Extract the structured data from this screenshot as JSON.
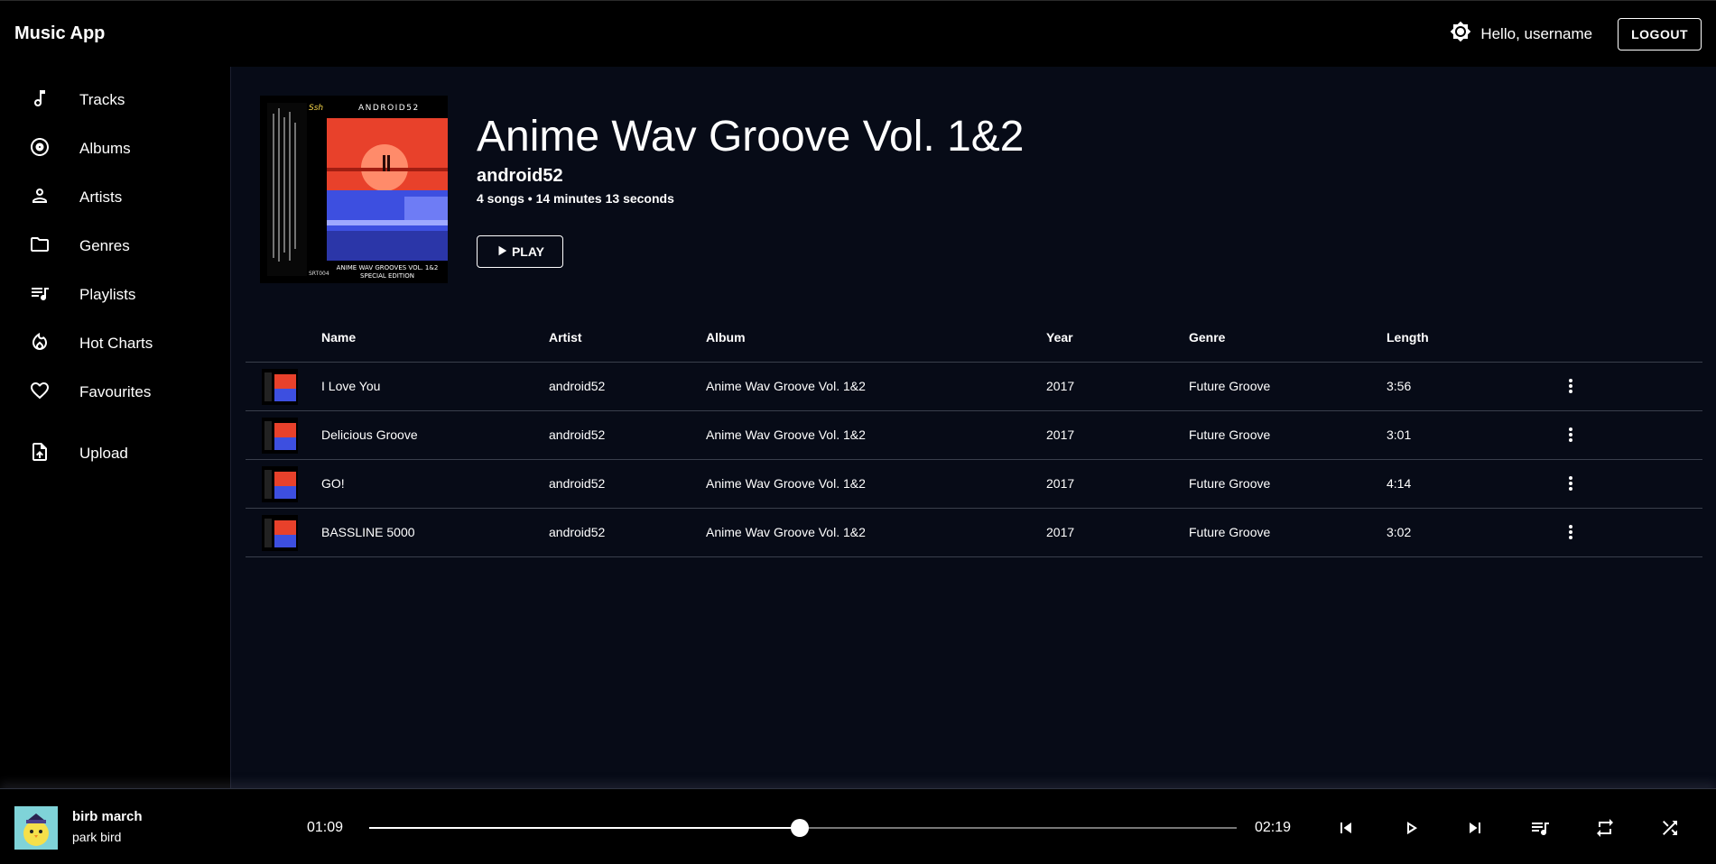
{
  "app": {
    "title": "Music App"
  },
  "header": {
    "greeting": "Hello, username",
    "logout_label": "LOGOUT",
    "theme_icon": "brightness-icon"
  },
  "sidebar": {
    "items": [
      {
        "label": "Tracks",
        "icon": "music-note-icon"
      },
      {
        "label": "Albums",
        "icon": "album-icon"
      },
      {
        "label": "Artists",
        "icon": "person-icon"
      },
      {
        "label": "Genres",
        "icon": "folder-icon"
      },
      {
        "label": "Playlists",
        "icon": "playlist-icon"
      },
      {
        "label": "Hot Charts",
        "icon": "flame-icon"
      },
      {
        "label": "Favourites",
        "icon": "heart-icon"
      },
      {
        "label": "Upload",
        "icon": "upload-file-icon"
      }
    ]
  },
  "album": {
    "title": "Anime Wav Groove Vol. 1&2",
    "artist": "android52",
    "meta": "4 songs • 14 minutes 13 seconds",
    "play_label": "PLAY",
    "cover": {
      "brand": "ANDROID52",
      "caption1": "ANIME WAV GROOVES VOL. 1&2",
      "caption2": "SPECIAL EDITION",
      "code": "SRT004"
    }
  },
  "table": {
    "columns": [
      "Name",
      "Artist",
      "Album",
      "Year",
      "Genre",
      "Length"
    ],
    "rows": [
      {
        "name": "I Love You",
        "artist": "android52",
        "album": "Anime Wav Groove Vol. 1&2",
        "year": "2017",
        "genre": "Future Groove",
        "length": "3:56"
      },
      {
        "name": "Delicious Groove",
        "artist": "android52",
        "album": "Anime Wav Groove Vol. 1&2",
        "year": "2017",
        "genre": "Future Groove",
        "length": "3:01"
      },
      {
        "name": "GO!",
        "artist": "android52",
        "album": "Anime Wav Groove Vol. 1&2",
        "year": "2017",
        "genre": "Future Groove",
        "length": "4:14"
      },
      {
        "name": "BASSLINE 5000",
        "artist": "android52",
        "album": "Anime Wav Groove Vol. 1&2",
        "year": "2017",
        "genre": "Future Groove",
        "length": "3:02"
      }
    ]
  },
  "player": {
    "title": "birb march",
    "artist": "park bird",
    "current_time": "01:09",
    "total_time": "02:19",
    "progress": 0.496
  },
  "colors": {
    "background": "#070b17",
    "sidebar": "#000000",
    "cover_red": "#e8412b",
    "cover_blue": "#3d4fe0"
  }
}
